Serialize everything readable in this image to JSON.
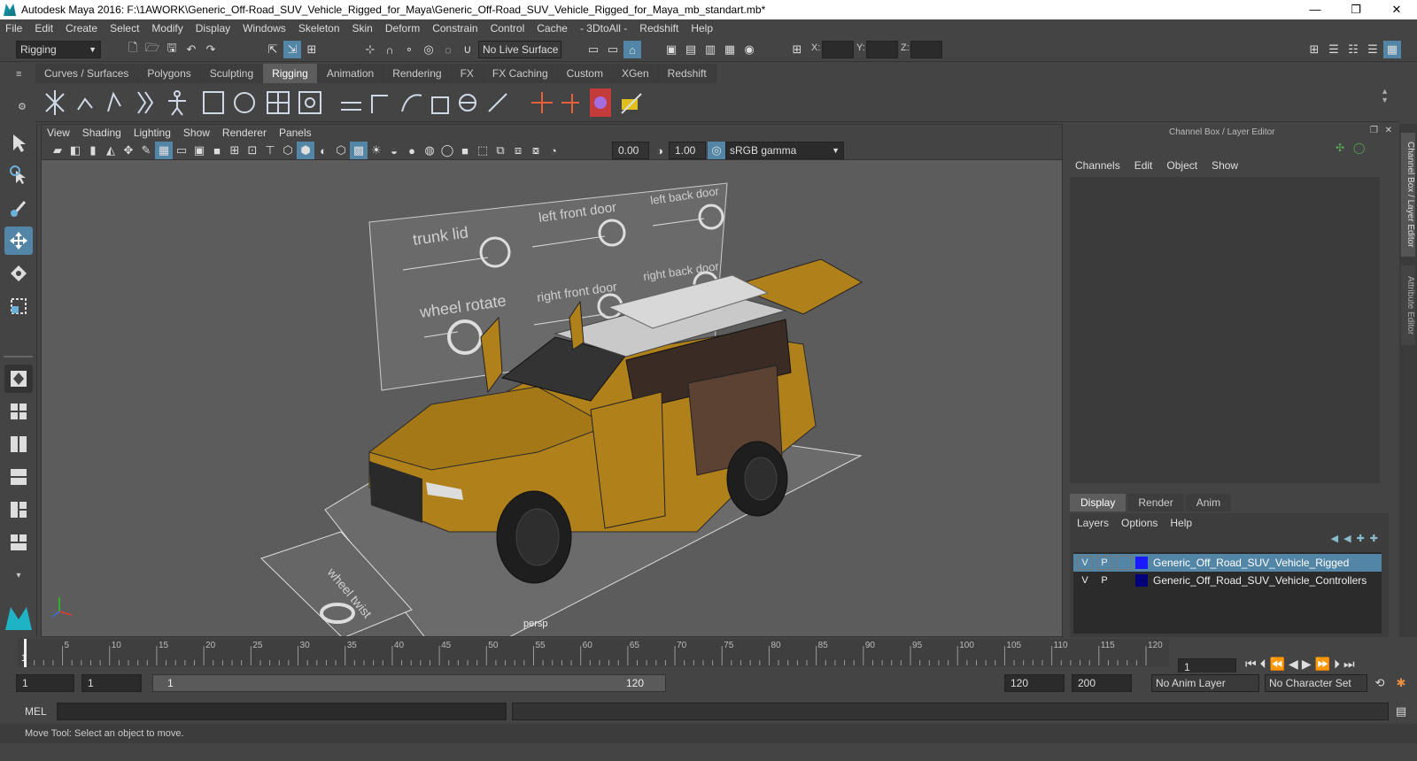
{
  "window": {
    "title": "Autodesk Maya 2016: F:\\1AWORK\\Generic_Off-Road_SUV_Vehicle_Rigged_for_Maya\\Generic_Off-Road_SUV_Vehicle_Rigged_for_Maya_mb_standart.mb*",
    "minimize": "—",
    "maximize": "❐",
    "close": "✕"
  },
  "menubar": [
    "File",
    "Edit",
    "Create",
    "Select",
    "Modify",
    "Display",
    "Windows",
    "Skeleton",
    "Skin",
    "Deform",
    "Constrain",
    "Control",
    "Cache",
    "- 3DtoAll -",
    "Redshift",
    "Help"
  ],
  "statusline": {
    "menuset": "Rigging",
    "live_surface": "No Live Surface",
    "x_label": "X:",
    "y_label": "Y:",
    "z_label": "Z:"
  },
  "shelf": {
    "tabs": [
      "Curves / Surfaces",
      "Polygons",
      "Sculpting",
      "Rigging",
      "Animation",
      "Rendering",
      "FX",
      "FX Caching",
      "Custom",
      "XGen",
      "Redshift"
    ],
    "active_tab": "Rigging"
  },
  "viewport": {
    "menu": [
      "View",
      "Shading",
      "Lighting",
      "Show",
      "Renderer",
      "Panels"
    ],
    "exposure": "0.00",
    "gamma": "1.00",
    "colorspace": "sRGB gamma",
    "camera_label": "persp",
    "controller_labels": {
      "trunk_lid": "trunk lid",
      "left_front_door": "left front door",
      "left_back_door": "left back door",
      "wheel_rotate": "wheel rotate",
      "right_front_door": "right front door",
      "right_back_door": "right back door",
      "wheel_twist": "wheel twist"
    },
    "colors": {
      "car_body": "#b0801a",
      "roof": "#c9c9c9",
      "background": "#5c5c5c"
    }
  },
  "channelbox": {
    "title": "Channel Box / Layer Editor",
    "menu": [
      "Channels",
      "Edit",
      "Object",
      "Show"
    ],
    "layer_tabs": [
      "Display",
      "Render",
      "Anim"
    ],
    "layer_menu": [
      "Layers",
      "Options",
      "Help"
    ],
    "layers": [
      {
        "v": "V",
        "p": "P",
        "color": "#1a1aff",
        "name": "Generic_Off_Road_SUV_Vehicle_Rigged",
        "selected": true
      },
      {
        "v": "V",
        "p": "P",
        "color": "#00007a",
        "name": "Generic_Off_Road_SUV_Vehicle_Controllers",
        "selected": false
      }
    ],
    "side_tabs": [
      "Channel Box / Layer Editor",
      "Attribute Editor"
    ]
  },
  "timeline": {
    "ticks": [
      "5",
      "10",
      "15",
      "20",
      "25",
      "30",
      "35",
      "40",
      "45",
      "50",
      "55",
      "60",
      "65",
      "70",
      "75",
      "80",
      "85",
      "90",
      "95",
      "100",
      "105",
      "110",
      "115",
      "120"
    ],
    "current_frame_marker": "1",
    "current_frame_field": "1"
  },
  "range": {
    "start": "1",
    "playback_start": "1",
    "slider_start": "1",
    "slider_end": "120",
    "playback_end": "120",
    "end": "200",
    "anim_layer": "No Anim Layer",
    "character_set": "No Character Set"
  },
  "cmdline": {
    "label": "MEL"
  },
  "helpline": {
    "text": "Move Tool: Select an object to move."
  }
}
